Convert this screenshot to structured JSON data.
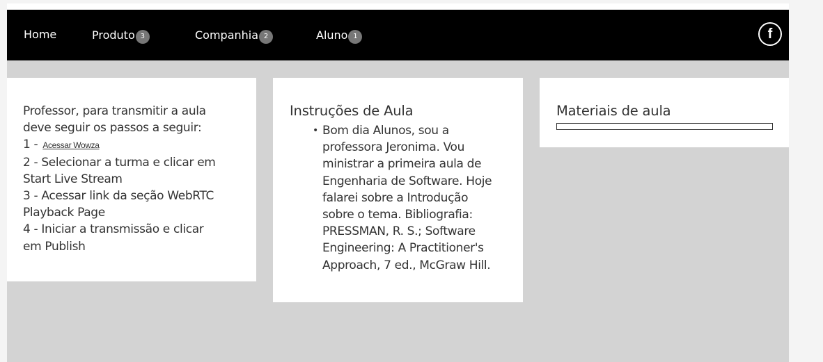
{
  "nav": {
    "items": [
      {
        "label": "Home",
        "badge": ""
      },
      {
        "label": "Produto",
        "badge": "3"
      },
      {
        "label": "Companhia",
        "badge": "2"
      },
      {
        "label": "Aluno",
        "badge": "1"
      }
    ],
    "facebook_glyph": "f"
  },
  "professor_panel": {
    "lines": [
      "Professor, para transmitir a aula",
      "deve seguir os passos a seguir:",
      "1 -",
      "2 - Selecionar a turma e clicar em",
      "Start Live Stream",
      "3 - Acessar link da seção WebRTC",
      "Playback Page",
      "4 - Iniciar a transmissão e clicar",
      "em Publish"
    ],
    "link_label": "Acessar Wowza"
  },
  "instructions_panel": {
    "title": "Instruções de Aula",
    "bullet": "•",
    "lines": [
      "Bom dia Alunos, sou a",
      "professora Jeronima. Vou",
      "ministrar a primeira aula de",
      "Engenharia de Software. Hoje",
      "falarei sobre a Introdução",
      "sobre o tema. Bibliografia:",
      "PRESSMAN, R. S.; Software",
      "Engineering: A Practitioner's",
      "Approach, 7 ed., McGraw Hill."
    ]
  },
  "materials_panel": {
    "title": "Materiais de aula"
  }
}
